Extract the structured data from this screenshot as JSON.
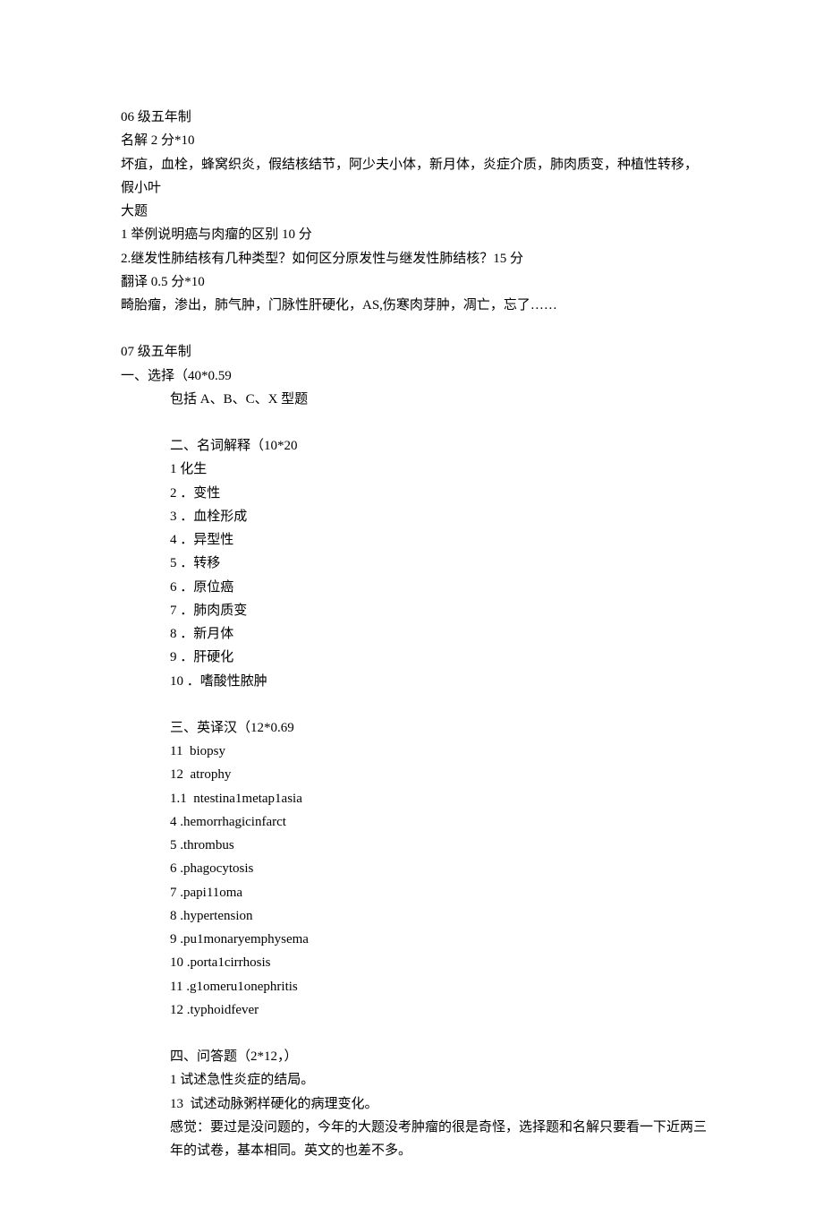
{
  "s06": {
    "title": "06 级五年制",
    "mingjieHeader": "名解 2 分*10",
    "mingjieBody": "坏疽，血栓，蜂窝织炎，假结核结节，阿少夫小体，新月体，炎症介质，肺肉质变，种植性转移，假小叶",
    "datiHeader": "大题",
    "dati1": "1 举例说明癌与肉瘤的区别 10 分",
    "dati2": "2.继发性肺结核有几种类型？如何区分原发性与继发性肺结核？15 分",
    "fanyiHeader": "翻译 0.5 分*10",
    "fanyiBody": "畸胎瘤，渗出，肺气肿，门脉性肝硬化，AS,伤寒肉芽肿，凋亡，忘了……"
  },
  "s07": {
    "title": "07 级五年制",
    "sec1": {
      "header": "一、选择（40*0.59",
      "sub": "包括 A、B、C、X 型题"
    },
    "sec2": {
      "header": "二、名词解释（10*20",
      "items": [
        "1 化生",
        "2 ．变性",
        "3 ．血栓形成",
        "4 ．异型性",
        "5 ．转移",
        "6 ．原位癌",
        "7 ．肺肉质变",
        "8 ．新月体",
        "9 ．肝硬化",
        "10 ．嗜酸性脓肿"
      ]
    },
    "sec3": {
      "header": "三、英译汉（12*0.69",
      "items": [
        "11  biopsy",
        "12  atrophy",
        "1.1  ntestina1metap1asia",
        "4 .hemorrhagicinfarct",
        "5 .thrombus",
        "6 .phagocytosis",
        "7 .papi11oma",
        "8 .hypertension",
        "9 .pu1monaryemphysema",
        "10 .porta1cirrhosis",
        "11 .g1omeru1onephritis",
        "12 .typhoidfever"
      ]
    },
    "sec4": {
      "header": "四、问答题（2*12，）",
      "items": [
        "1 试述急性炎症的结局。",
        "13  试述动脉粥样硬化的病理变化。"
      ]
    },
    "note": "感觉：要过是没问题的，今年的大题没考肿瘤的很是奇怪，选择题和名解只要看一下近两三年的试卷，基本相同。英文的也差不多。"
  }
}
